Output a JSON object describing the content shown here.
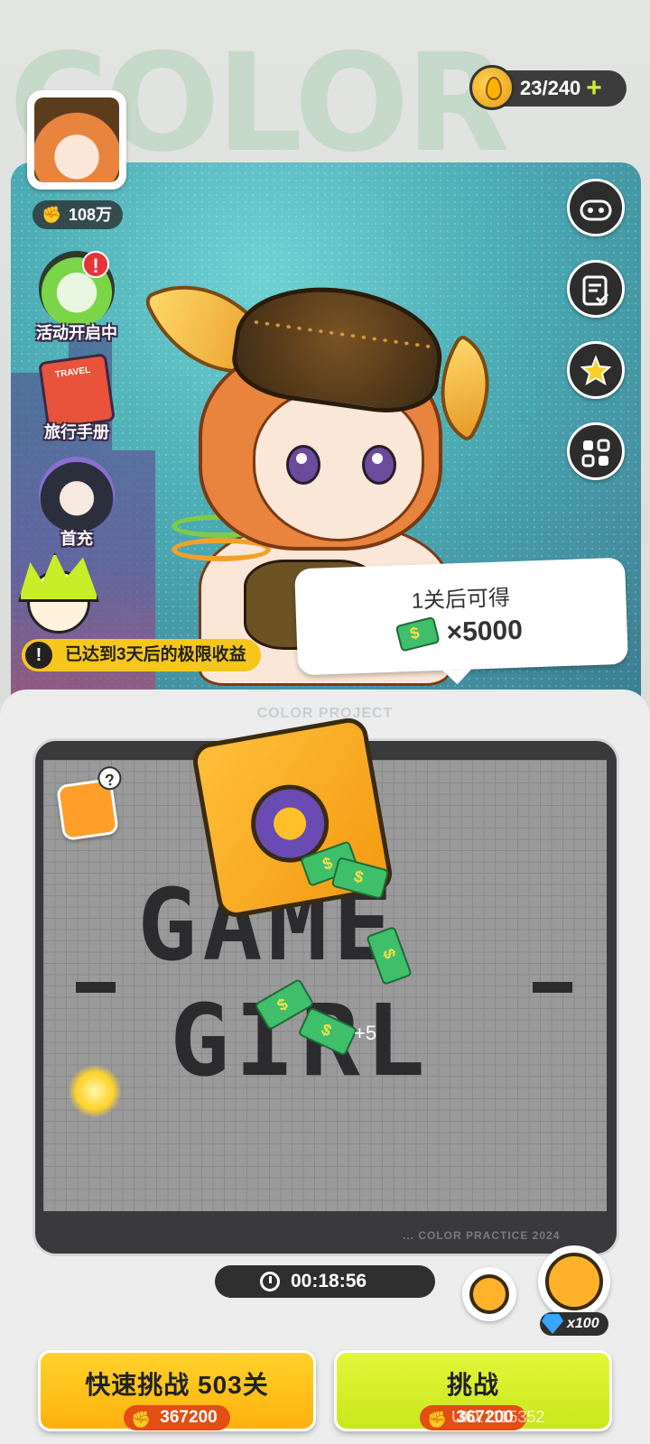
{
  "background_word": "COLOR",
  "energy": {
    "value": "23/240",
    "plus": "+"
  },
  "player": {
    "power": "108万"
  },
  "side_menu": [
    {
      "id": "event",
      "label": "活动开启中",
      "alert": "!"
    },
    {
      "id": "travel",
      "label": "旅行手册",
      "book_text": "TRAVEL"
    },
    {
      "id": "first_charge",
      "label": "首充"
    }
  ],
  "right_buttons": [
    "gamepad-icon",
    "checklist-icon",
    "star-burst-icon",
    "grid-menu-icon"
  ],
  "reward_bubble": {
    "line1": "1关后可得",
    "amount": "×5000"
  },
  "warning": {
    "icon": "!",
    "text": "已达到3天后的极限收益"
  },
  "board": {
    "project_title": "COLOR PROJECT",
    "word1": "GAME",
    "word2": "GIRL",
    "gain": "+5",
    "footer": "... COLOR PRACTICE 2024",
    "help": "?"
  },
  "timer": "00:18:56",
  "boost": {
    "cost": "x100"
  },
  "buttons": {
    "quick": {
      "label": "快速挑战 503关",
      "cost": "367200"
    },
    "challenge": {
      "label": "挑战",
      "cost": "367200"
    }
  },
  "uid": "UID:1115352",
  "colors": {
    "accent_yellow": "#ffc21a",
    "accent_lime": "#d4ee2a",
    "cost_orange": "#e34e12",
    "board_dark": "#3a3a3c"
  }
}
